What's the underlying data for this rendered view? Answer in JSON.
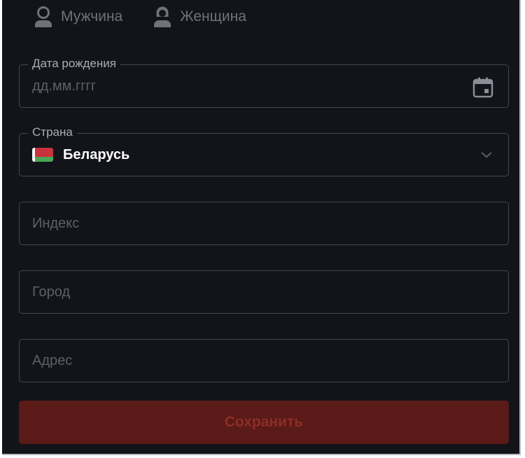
{
  "gender": {
    "male_label": "Мужчина",
    "female_label": "Женщина",
    "male_icon": "user-male-icon",
    "female_icon": "user-female-icon"
  },
  "birth_date": {
    "label": "Дата рождения",
    "placeholder": "дд.мм.гггг",
    "icon": "calendar-icon"
  },
  "country": {
    "label": "Страна",
    "selected": "Беларусь",
    "flag_icon": "belarus-flag-icon",
    "dropdown_icon": "chevron-down-icon"
  },
  "postal_code": {
    "placeholder": "Индекс"
  },
  "city": {
    "placeholder": "Город"
  },
  "address": {
    "placeholder": "Адрес"
  },
  "save": {
    "label": "Сохранить"
  },
  "colors": {
    "background": "#121419",
    "field_border": "#444851",
    "button_bg": "#5a1a17",
    "button_text": "#8d2d28",
    "flag_red": "#c8313e",
    "flag_green": "#4aa657"
  }
}
